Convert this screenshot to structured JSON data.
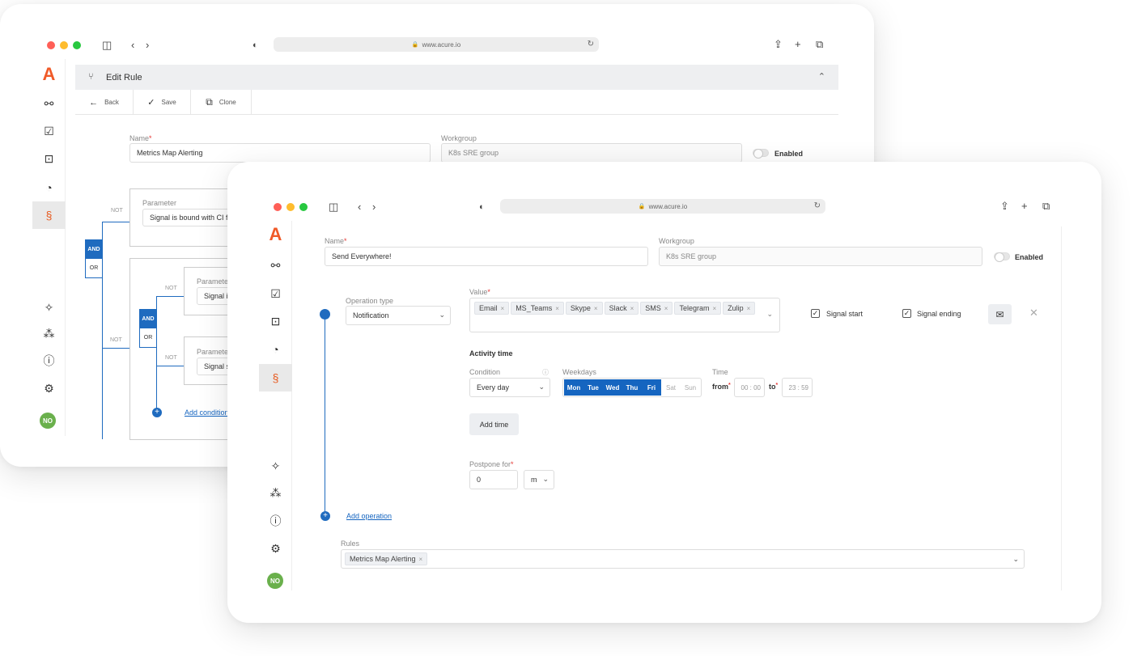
{
  "back_window": {
    "url": "www.acure.io",
    "header_title": "Edit Rule",
    "toolbar": {
      "back": "Back",
      "save": "Save",
      "clone": "Clone"
    },
    "name_label": "Name",
    "name_value": "Metrics Map Alerting",
    "workgroup_label": "Workgroup",
    "workgroup_value": "K8s SRE group",
    "enabled_label": "Enabled",
    "tree": {
      "and": "AND",
      "or": "OR",
      "not": "NOT",
      "param_label": "Parameter",
      "param_label_short": "Paramete",
      "param1_value": "Signal is bound with CI f",
      "param2_value": "Signal i",
      "param3_value": "Signal s",
      "add_condition": "Add condition"
    },
    "avatar": "NO"
  },
  "front_window": {
    "url": "www.acure.io",
    "name_label": "Name",
    "name_value": "Send Everywhere!",
    "workgroup_label": "Workgroup",
    "workgroup_value": "K8s SRE group",
    "enabled_label": "Enabled",
    "operation_type_label": "Operation type",
    "operation_type_value": "Notification",
    "value_label": "Value",
    "value_chips": [
      "Email",
      "MS_Teams",
      "Skype",
      "Slack",
      "SMS",
      "Telegram",
      "Zulip"
    ],
    "signal_start_label": "Signal start",
    "signal_ending_label": "Signal ending",
    "activity_time_label": "Activity time",
    "condition_label": "Condition",
    "condition_value": "Every day",
    "weekdays_label": "Weekdays",
    "weekdays": [
      {
        "label": "Mon",
        "on": true
      },
      {
        "label": "Tue",
        "on": true
      },
      {
        "label": "Wed",
        "on": true
      },
      {
        "label": "Thu",
        "on": true
      },
      {
        "label": "Fri",
        "on": true
      },
      {
        "label": "Sat",
        "on": false
      },
      {
        "label": "Sun",
        "on": false
      }
    ],
    "time_label": "Time",
    "from_label": "from",
    "from_value": "00 : 00",
    "to_label": "to",
    "to_value": "23 : 59",
    "add_time_label": "Add time",
    "postpone_label": "Postpone for",
    "postpone_value": "0",
    "postpone_unit": "m",
    "add_operation_label": "Add operation",
    "rules_label": "Rules",
    "rules_chip": "Metrics Map Alerting",
    "avatar": "NO"
  },
  "colors": {
    "accent": "#1565c0",
    "brand": "#f05a28",
    "avatar": "#6ab04c"
  }
}
